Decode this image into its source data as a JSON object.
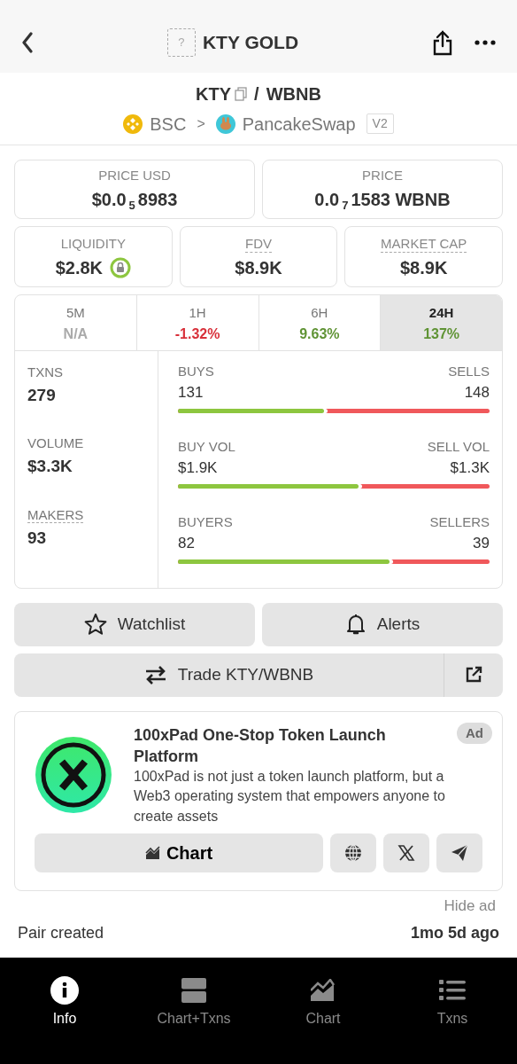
{
  "header": {
    "title": "KTY GOLD",
    "token_icon": "?"
  },
  "pair": {
    "base": "KTY",
    "separator": "/",
    "quote": "WBNB",
    "chain": "BSC",
    "chevron": ">",
    "dex": "PancakeSwap",
    "version": "V2"
  },
  "price_boxes": [
    {
      "label": "PRICE USD",
      "value": "$0.0$_{5}$8983",
      "dashed": false
    },
    {
      "label": "PRICE",
      "value": "0.0$_{7}$1583 WBNB",
      "dashed": false
    }
  ],
  "stat_boxes": [
    {
      "label": "LIQUIDITY",
      "value": "$2.8K",
      "dashed": false,
      "locked": true
    },
    {
      "label": "FDV",
      "value": "$8.9K",
      "dashed": true,
      "locked": false
    },
    {
      "label": "MARKET CAP",
      "value": "$8.9K",
      "dashed": true,
      "locked": false
    }
  ],
  "timeframes": [
    {
      "label": "5M",
      "value": "N/A",
      "color": "#aaaaaa",
      "selected": false
    },
    {
      "label": "1H",
      "value": "-1.32%",
      "color": "#d8303a",
      "selected": false
    },
    {
      "label": "6H",
      "value": "9.63%",
      "color": "#5f9334",
      "selected": false
    },
    {
      "label": "24H",
      "value": "137%",
      "color": "#5f9334",
      "selected": true
    }
  ],
  "stats": [
    {
      "label": "TXNS",
      "value": "279",
      "dashed": false,
      "left_label": "BUYS",
      "left_value": "131",
      "right_label": "SELLS",
      "right_value": "148",
      "level": 0.47
    },
    {
      "label": "VOLUME",
      "value": "$3.3K",
      "dashed": false,
      "left_label": "BUY VOL",
      "left_value": "$1.9K",
      "right_label": "SELL VOL",
      "right_value": "$1.3K",
      "level": 0.58
    },
    {
      "label": "MAKERS",
      "value": "93",
      "dashed": true,
      "left_label": "BUYERS",
      "left_value": "82",
      "right_label": "SELLERS",
      "right_value": "39",
      "level": 0.68
    }
  ],
  "actions": {
    "watchlist": "Watchlist",
    "alerts": "Alerts",
    "trade": "Trade KTY/WBNB"
  },
  "ad": {
    "badge": "Ad",
    "title": "100xPad One-Stop Token Launch Platform",
    "description": "100xPad is not just a token launch platform, but a Web3 operating system that empowers anyone to create assets",
    "chart_button": "Chart",
    "hide": "Hide ad"
  },
  "info_rows": [
    {
      "label": "Pair created",
      "value": "1mo 5d ago"
    }
  ],
  "bottom_tabs": [
    {
      "label": "Info",
      "kind": "info",
      "selected": true
    },
    {
      "label": "Chart+Txns",
      "kind": "split",
      "selected": false
    },
    {
      "label": "Chart",
      "kind": "chart",
      "selected": false
    },
    {
      "label": "Txns",
      "kind": "list",
      "selected": false
    }
  ]
}
